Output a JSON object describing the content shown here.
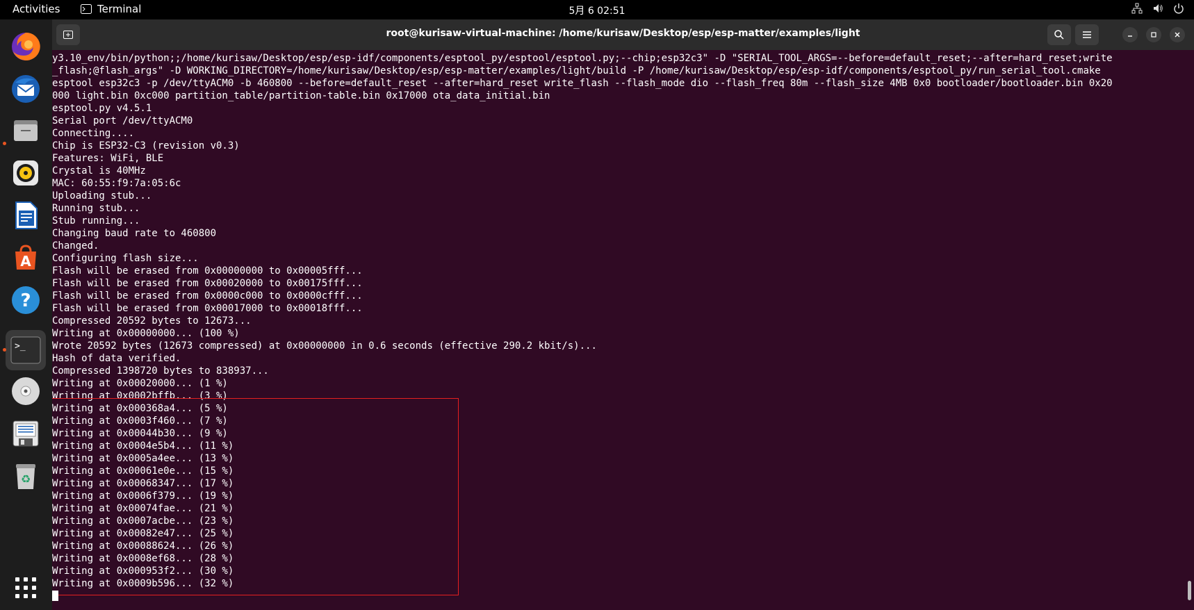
{
  "topbar": {
    "activities": "Activities",
    "app_name": "Terminal",
    "clock": "5月 6  02:51"
  },
  "dock": {
    "items": [
      {
        "name": "firefox-icon"
      },
      {
        "name": "thunderbird-icon"
      },
      {
        "name": "files-icon"
      },
      {
        "name": "rhythmbox-icon"
      },
      {
        "name": "writer-icon"
      },
      {
        "name": "app-center-icon"
      },
      {
        "name": "help-icon"
      },
      {
        "name": "terminal-icon"
      },
      {
        "name": "disc-icon"
      },
      {
        "name": "floppy-icon"
      },
      {
        "name": "trash-icon"
      },
      {
        "name": "show-apps-icon"
      }
    ]
  },
  "window": {
    "title": "root@kurisaw-virtual-machine: /home/kurisaw/Desktop/esp/esp-matter/examples/light"
  },
  "terminal": {
    "lines": [
      "y3.10_env/bin/python;;/home/kurisaw/Desktop/esp/esp-idf/components/esptool_py/esptool/esptool.py;--chip;esp32c3\" -D \"SERIAL_TOOL_ARGS=--before=default_reset;--after=hard_reset;write",
      "_flash;@flash_args\" -D WORKING_DIRECTORY=/home/kurisaw/Desktop/esp/esp-matter/examples/light/build -P /home/kurisaw/Desktop/esp/esp-idf/components/esptool_py/run_serial_tool.cmake",
      "esptool esp32c3 -p /dev/ttyACM0 -b 460800 --before=default_reset --after=hard_reset write_flash --flash_mode dio --flash_freq 80m --flash_size 4MB 0x0 bootloader/bootloader.bin 0x20",
      "000 light.bin 0xc000 partition_table/partition-table.bin 0x17000 ota_data_initial.bin",
      "esptool.py v4.5.1",
      "Serial port /dev/ttyACM0",
      "Connecting....",
      "Chip is ESP32-C3 (revision v0.3)",
      "Features: WiFi, BLE",
      "Crystal is 40MHz",
      "MAC: 60:55:f9:7a:05:6c",
      "Uploading stub...",
      "Running stub...",
      "Stub running...",
      "Changing baud rate to 460800",
      "Changed.",
      "Configuring flash size...",
      "Flash will be erased from 0x00000000 to 0x00005fff...",
      "Flash will be erased from 0x00020000 to 0x00175fff...",
      "Flash will be erased from 0x0000c000 to 0x0000cfff...",
      "Flash will be erased from 0x00017000 to 0x00018fff...",
      "Compressed 20592 bytes to 12673...",
      "Writing at 0x00000000... (100 %)",
      "Wrote 20592 bytes (12673 compressed) at 0x00000000 in 0.6 seconds (effective 290.2 kbit/s)...",
      "Hash of data verified.",
      "Compressed 1398720 bytes to 838937...",
      "Writing at 0x00020000... (1 %)",
      "Writing at 0x0002bffb... (3 %)",
      "Writing at 0x000368a4... (5 %)",
      "Writing at 0x0003f460... (7 %)",
      "Writing at 0x00044b30... (9 %)",
      "Writing at 0x0004e5b4... (11 %)",
      "Writing at 0x0005a4ee... (13 %)",
      "Writing at 0x00061e0e... (15 %)",
      "Writing at 0x00068347... (17 %)",
      "Writing at 0x0006f379... (19 %)",
      "Writing at 0x00074fae... (21 %)",
      "Writing at 0x0007acbe... (23 %)",
      "Writing at 0x00082e47... (25 %)",
      "Writing at 0x00088624... (26 %)",
      "Writing at 0x0008ef68... (28 %)",
      "Writing at 0x000953f2... (30 %)",
      "Writing at 0x0009b596... (32 %)"
    ]
  },
  "colors": {
    "terminal_bg": "#300a24",
    "highlight": "#e62020",
    "accent": "#e95420"
  }
}
